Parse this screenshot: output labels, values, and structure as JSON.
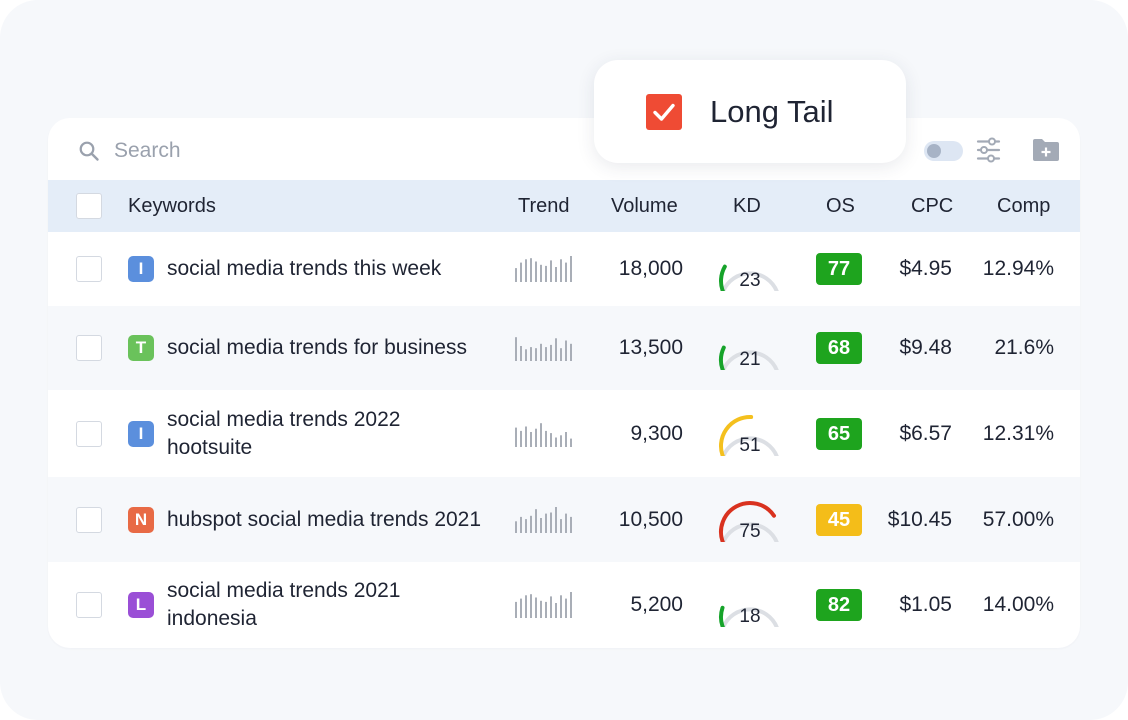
{
  "search": {
    "placeholder": "Search"
  },
  "popup": {
    "label": "Long Tail",
    "checked": true,
    "color": "#ef4b34"
  },
  "table": {
    "headers": {
      "keywords": "Keywords",
      "trend": "Trend",
      "volume": "Volume",
      "kd": "KD",
      "os": "OS",
      "cpc": "CPC",
      "comp": "Comp"
    },
    "rows": [
      {
        "keyword": "social media trends this week",
        "intent": "I",
        "intent_color": "#5b8fdd",
        "trend": [
          0.45,
          0.7,
          0.85,
          0.9,
          0.75,
          0.6,
          0.55,
          0.8,
          0.5,
          0.85,
          0.7,
          1.0
        ],
        "volume": "18,000",
        "kd": 23,
        "kd_color": "#16a32a",
        "os": "77",
        "os_color": "#1ea41e",
        "cpc": "$4.95",
        "comp": "12.94%"
      },
      {
        "keyword": "social media trends for business",
        "intent": "T",
        "intent_color": "#6ac25b",
        "trend": [
          0.9,
          0.5,
          0.35,
          0.45,
          0.4,
          0.6,
          0.45,
          0.55,
          0.85,
          0.4,
          0.75,
          0.6
        ],
        "volume": "13,500",
        "kd": 21,
        "kd_color": "#16a32a",
        "os": "68",
        "os_color": "#1ea41e",
        "cpc": "$9.48",
        "comp": "21.6%"
      },
      {
        "keyword": "social media trends 2022 hootsuite",
        "intent": "I",
        "intent_color": "#5b8fdd",
        "trend": [
          0.7,
          0.55,
          0.75,
          0.5,
          0.65,
          0.9,
          0.55,
          0.45,
          0.25,
          0.35,
          0.5,
          0.2
        ],
        "volume": "9,300",
        "kd": 51,
        "kd_color": "#f4c01e",
        "os": "65",
        "os_color": "#1ea41e",
        "cpc": "$6.57",
        "comp": "12.31%"
      },
      {
        "keyword": "hubspot social media trends 2021",
        "intent": "N",
        "intent_color": "#e86a45",
        "trend": [
          0.35,
          0.55,
          0.45,
          0.6,
          0.9,
          0.5,
          0.7,
          0.75,
          1.0,
          0.45,
          0.7,
          0.55
        ],
        "volume": "10,500",
        "kd": 75,
        "kd_color": "#d9321f",
        "os": "45",
        "os_color": "#f4bd19",
        "cpc": "$10.45",
        "comp": "57.00%"
      },
      {
        "keyword": "social media trends 2021 indonesia",
        "intent": "L",
        "intent_color": "#9a4fd6",
        "trend": [
          0.55,
          0.7,
          0.85,
          0.9,
          0.75,
          0.6,
          0.55,
          0.8,
          0.5,
          0.85,
          0.7,
          1.0
        ],
        "volume": "5,200",
        "kd": 18,
        "kd_color": "#16a32a",
        "os": "82",
        "os_color": "#1ea41e",
        "cpc": "$1.05",
        "comp": "14.00%"
      }
    ]
  }
}
